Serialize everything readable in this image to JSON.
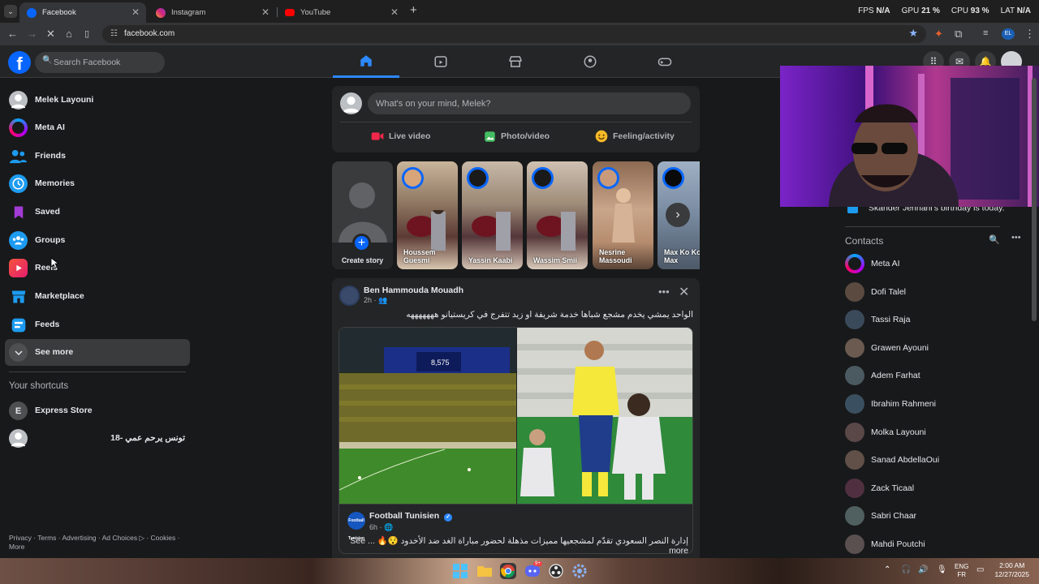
{
  "browser": {
    "tabs": [
      {
        "title": "Facebook",
        "active": true
      },
      {
        "title": "Instagram",
        "active": false
      },
      {
        "title": "YouTube",
        "active": false
      }
    ],
    "url": "facebook.com",
    "system_monitor": {
      "fps_label": "FPS",
      "fps_value": "N/A",
      "gpu_label": "GPU",
      "gpu_value": "21 %",
      "cpu_label": "CPU",
      "cpu_value": "93 %",
      "lat_label": "LAT",
      "lat_value": "N/A"
    },
    "profile_badge": "EL"
  },
  "fb_nav": {
    "search_placeholder": "Search Facebook",
    "logo": "f"
  },
  "sidebar": {
    "items": [
      {
        "label": "Melek Layouni",
        "icon": "avatar"
      },
      {
        "label": "Meta AI",
        "icon": "meta-ai-icon"
      },
      {
        "label": "Friends",
        "icon": "friends-icon"
      },
      {
        "label": "Memories",
        "icon": "clock-icon"
      },
      {
        "label": "Saved",
        "icon": "bookmark-icon"
      },
      {
        "label": "Groups",
        "icon": "groups-icon"
      },
      {
        "label": "Reels",
        "icon": "reels-icon"
      },
      {
        "label": "Marketplace",
        "icon": "shop-icon"
      },
      {
        "label": "Feeds",
        "icon": "feeds-icon"
      }
    ],
    "see_more": "See more",
    "shortcuts_title": "Your shortcuts",
    "shortcuts": [
      {
        "label": "Express Store",
        "initial": "E"
      },
      {
        "label": "تونس يرحم عمي -18"
      }
    ],
    "footer": "Privacy · Terms · Advertising · Ad Choices ▷ · Cookies · More"
  },
  "composer": {
    "placeholder": "What's on your mind, Melek?",
    "actions": [
      {
        "label": "Live video",
        "color": "#f02849"
      },
      {
        "label": "Photo/video",
        "color": "#45bd62"
      },
      {
        "label": "Feeling/activity",
        "color": "#f7b928"
      }
    ]
  },
  "stories": {
    "create_label": "Create story",
    "items": [
      {
        "name": "Houssem Guesmi"
      },
      {
        "name": "Yassin Kaabi"
      },
      {
        "name": "Wassim Smii"
      },
      {
        "name": "Nesrine Massoudi"
      },
      {
        "name": "Max Ko Ko Max"
      }
    ]
  },
  "post": {
    "author": "Ben Hammouda Mouadh",
    "meta": "2h · 👥",
    "text": "الواحد يمشي يخدم مشجع شباها خدمة شريفة او زيد تتفرج في كريستيانو هههههههه",
    "shared": {
      "author": "Football Tunisien",
      "verified": "✓",
      "meta": "6h · 🌐",
      "avatar_text": "Football Tunisien",
      "text": "إدارة النصر السعودي تقدّم لمشجعيها مميزات مذهلة لحضور مباراة الغد ضد الأخدود 😯🔥 ... See more",
      "scoreboard": "8,575"
    }
  },
  "right": {
    "birthday": "Skander Jehnani's birthday is today.",
    "contacts_title": "Contacts",
    "contacts": [
      {
        "name": "Meta AI"
      },
      {
        "name": "Dofi Talel"
      },
      {
        "name": "Tassi Raja"
      },
      {
        "name": "Grawen Ayouni"
      },
      {
        "name": "Adem Farhat"
      },
      {
        "name": "Ibrahim Rahmeni"
      },
      {
        "name": "Molka Layouni"
      },
      {
        "name": "Sanad AbdellaOui"
      },
      {
        "name": "Zack Ticaal"
      },
      {
        "name": "Sabri Chaar"
      },
      {
        "name": "Mahdi Poutchi"
      }
    ]
  },
  "taskbar": {
    "lang_top": "ENG",
    "lang_bottom": "FR",
    "time": "2:00 AM",
    "date": "12/27/2025",
    "discord_badge": "9+"
  }
}
